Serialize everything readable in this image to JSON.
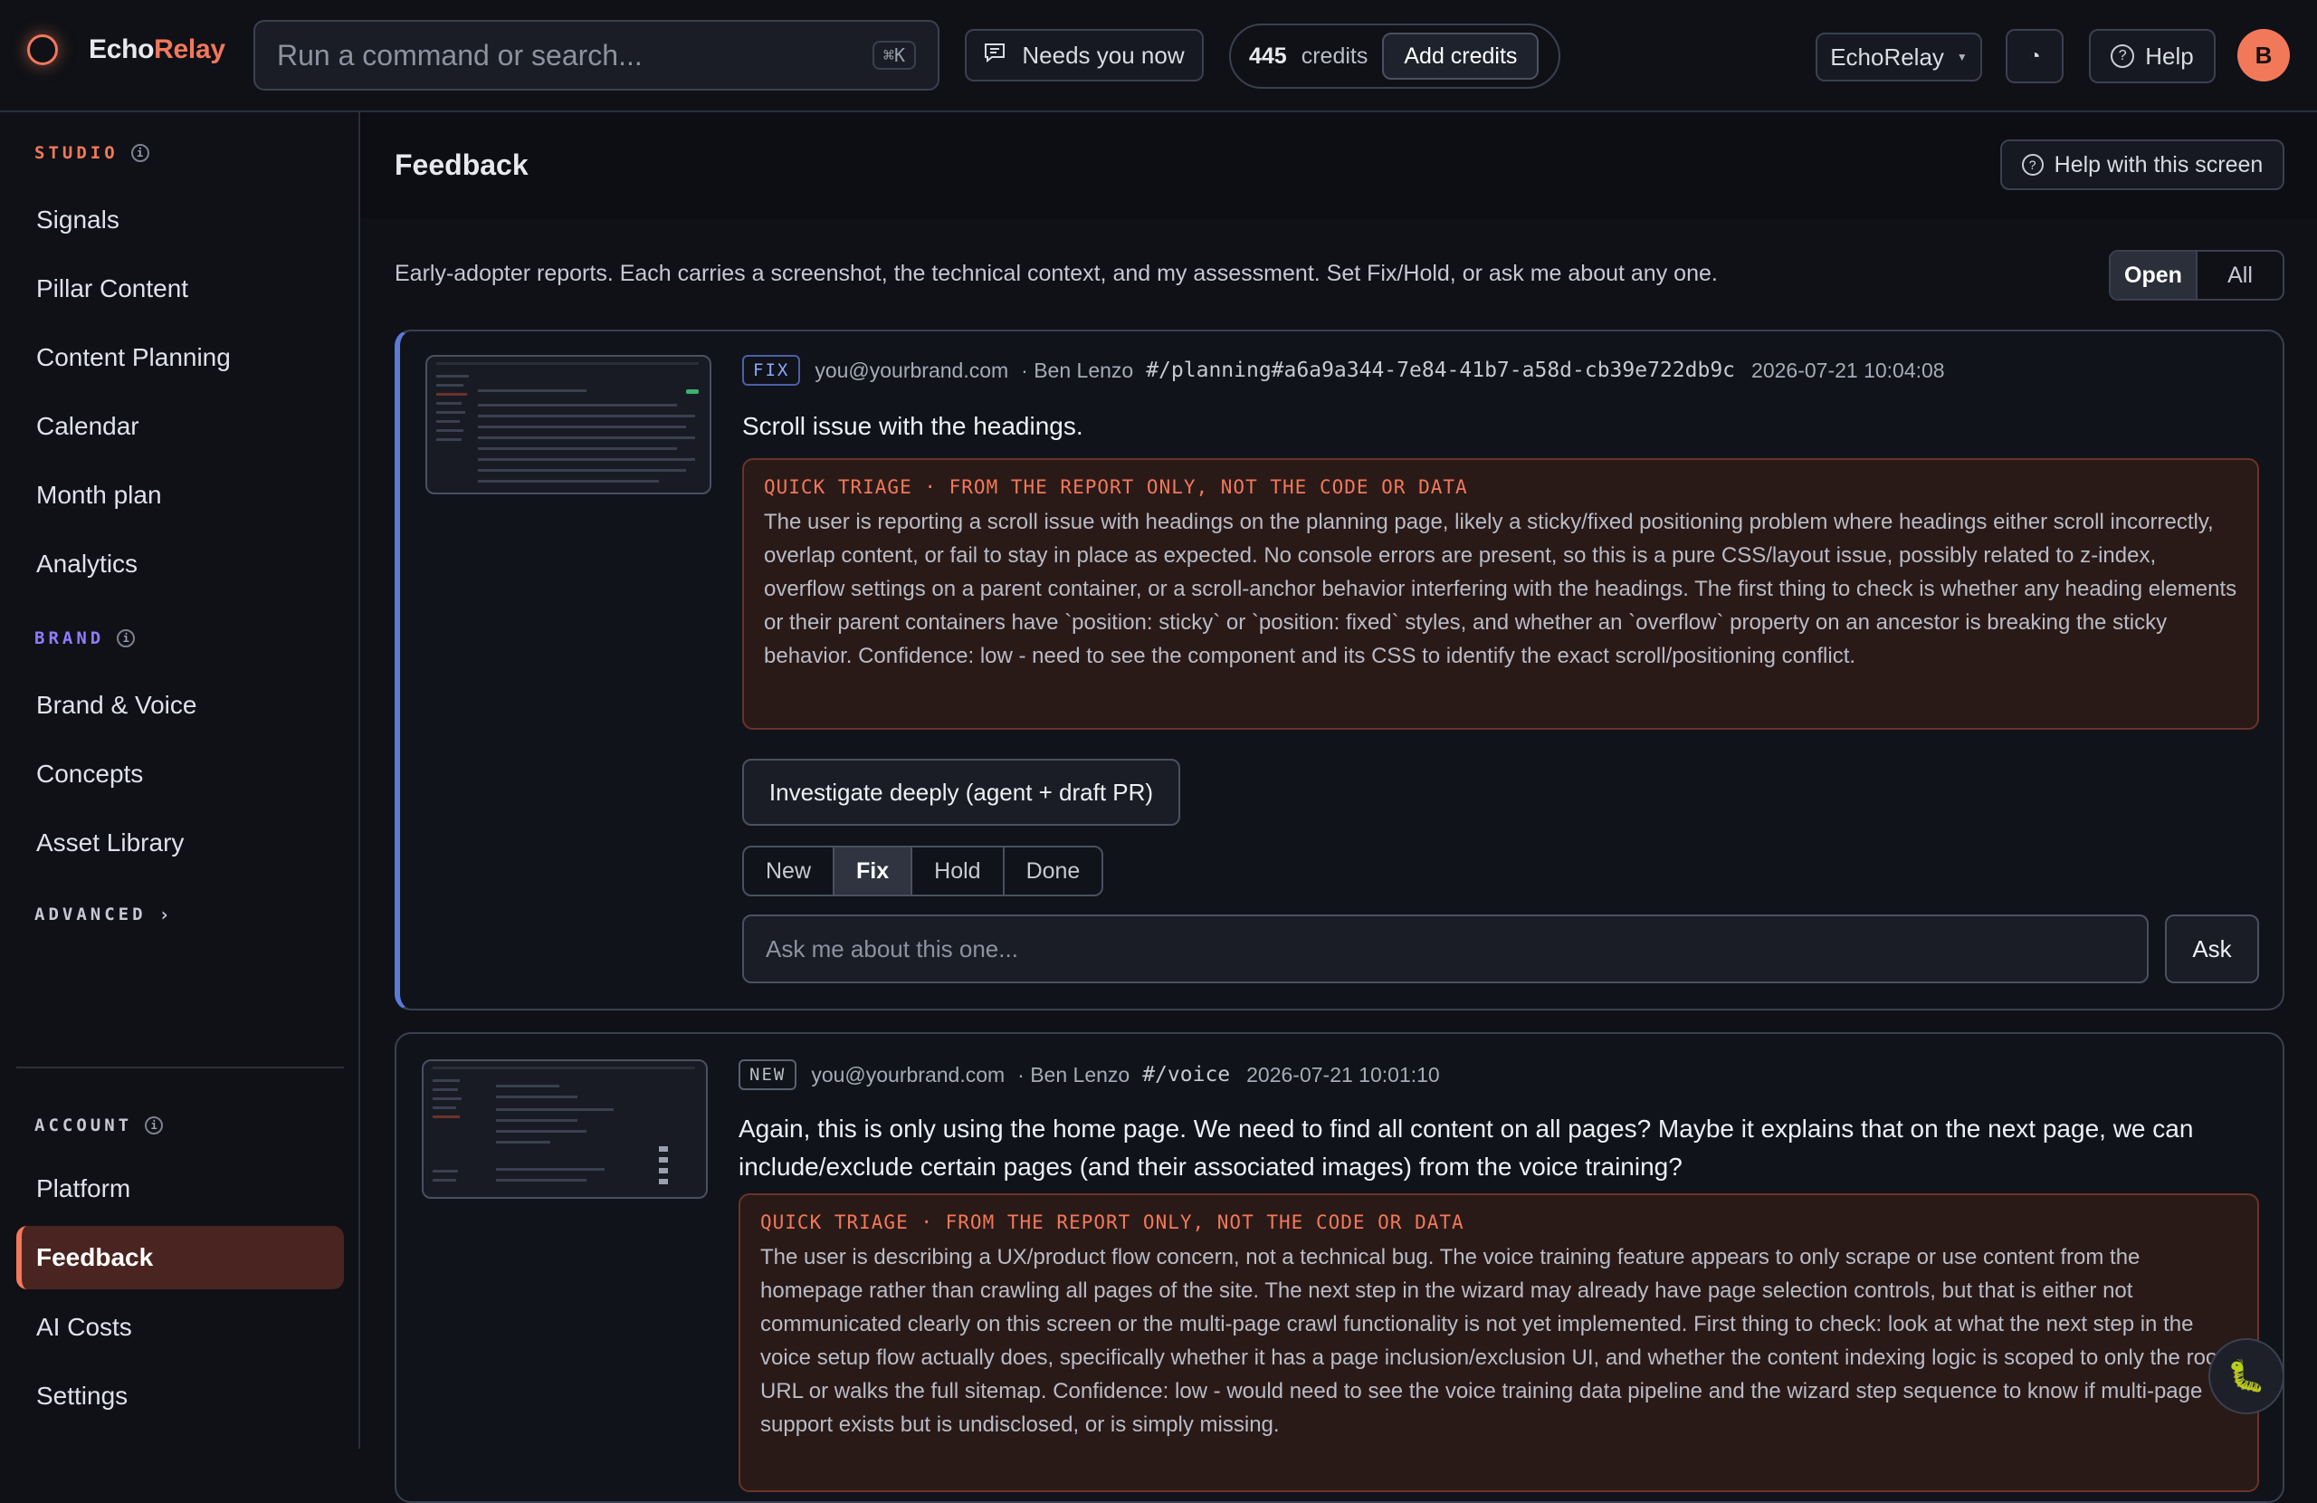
{
  "app": {
    "name_prefix": "Echo",
    "name_accent": "Relay",
    "accent_color": "#f2785a"
  },
  "topbar": {
    "search_placeholder": "Run a command or search...",
    "search_shortcut": "⌘K",
    "needs_label": "Needs you now",
    "credits_count": "445",
    "credits_label": "credits",
    "add_credits_label": "Add credits",
    "workspace": "EchoRelay",
    "theme_icon": "◔",
    "help_label": "Help",
    "avatar_initial": "B"
  },
  "sidebar": {
    "studio_label": "STUDIO",
    "studio_items": [
      "Signals",
      "Pillar Content",
      "Content Planning",
      "Calendar",
      "Month plan",
      "Analytics"
    ],
    "brand_label": "BRAND",
    "brand_items": [
      "Brand & Voice",
      "Concepts",
      "Asset Library"
    ],
    "advanced_label": "ADVANCED",
    "account_label": "ACCOUNT",
    "account_items": [
      "Platform",
      "Feedback",
      "AI Costs",
      "Settings"
    ],
    "active_item": "Feedback"
  },
  "main": {
    "title": "Feedback",
    "help_screen_label": "Help with this screen",
    "subtitle": "Early-adopter reports. Each carries a screenshot, the technical context, and my assessment. Set Fix/Hold, or ask me about any one.",
    "filters": [
      "Open",
      "All"
    ],
    "selected_filter": "Open"
  },
  "reports": [
    {
      "tag": "FIX",
      "email": "you@yourbrand.com",
      "author": "· Ben Lenzo",
      "route": "#/planning#a6a9a344-7e84-41b7-a58d-cb39e722db9c",
      "timestamp": "2026-07-21 10:04:08",
      "title": "Scroll issue with the headings.",
      "triage_label": "QUICK TRIAGE · FROM THE REPORT ONLY, NOT THE CODE OR DATA",
      "triage_text": "The user is reporting a scroll issue with headings on the planning page, likely a sticky/fixed positioning problem where headings either scroll incorrectly, overlap content, or fail to stay in place as expected. No console errors are present, so this is a pure CSS/layout issue, possibly related to z-index, overflow settings on a parent container, or a scroll-anchor behavior interfering with the headings. The first thing to check is whether any heading elements or their parent containers have `position: sticky` or `position: fixed` styles, and whether an `overflow` property on an ancestor is breaking the sticky behavior. Confidence: low - need to see the component and its CSS to identify the exact scroll/positioning conflict.",
      "investigate_label": "Investigate deeply (agent + draft PR)",
      "statuses": [
        "New",
        "Fix",
        "Hold",
        "Done"
      ],
      "selected_status": "Fix",
      "ask_placeholder": "Ask me about this one...",
      "ask_label": "Ask"
    },
    {
      "tag": "NEW",
      "email": "you@yourbrand.com",
      "author": "· Ben Lenzo",
      "route": "#/voice",
      "timestamp": "2026-07-21 10:01:10",
      "title": "Again, this is only using the home page. We need to find all content on all pages? Maybe it explains that on the next page, we can include/exclude certain pages (and their associated images) from the voice training?",
      "triage_label": "QUICK TRIAGE · FROM THE REPORT ONLY, NOT THE CODE OR DATA",
      "triage_text": "The user is describing a UX/product flow concern, not a technical bug. The voice training feature appears to only scrape or use content from the homepage rather than crawling all pages of the site. The next step in the wizard may already have page selection controls, but that is either not communicated clearly on this screen or the multi-page crawl functionality is not yet implemented. First thing to check: look at what the next step in the voice setup flow actually does, specifically whether it has a page inclusion/exclusion UI, and whether the content indexing logic is scoped to only the root URL or walks the full sitemap. Confidence: low - would need to see the voice training data pipeline and the wizard step sequence to know if multi-page support exists but is undisclosed, or is simply missing."
    }
  ],
  "fab_icon": "🐛"
}
